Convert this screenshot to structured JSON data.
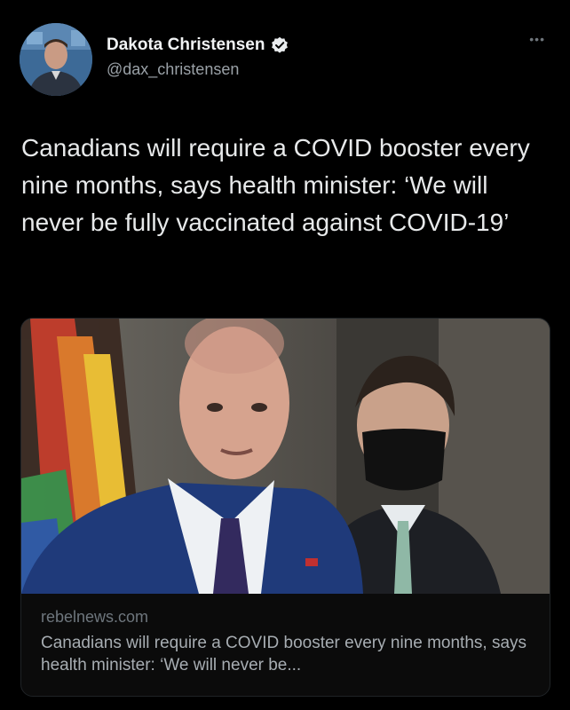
{
  "author": {
    "display_name": "Dakota Christensen",
    "handle": "@dax_christensen",
    "verified_icon": "verified-badge-icon",
    "avatar_icon": "avatar"
  },
  "more_icon": "more-options-icon",
  "tweet": {
    "text": "Canadians will require a COVID booster every nine months, says health minister: ‘We will never be fully vaccinated against COVID-19’"
  },
  "link_card": {
    "domain": "rebelnews.com",
    "title": "Canadians will require a COVID booster every nine months, says health minister: ‘We will never be..."
  },
  "colors": {
    "background": "#000000",
    "text": "#e7e9ea",
    "muted": "#6e767d"
  }
}
